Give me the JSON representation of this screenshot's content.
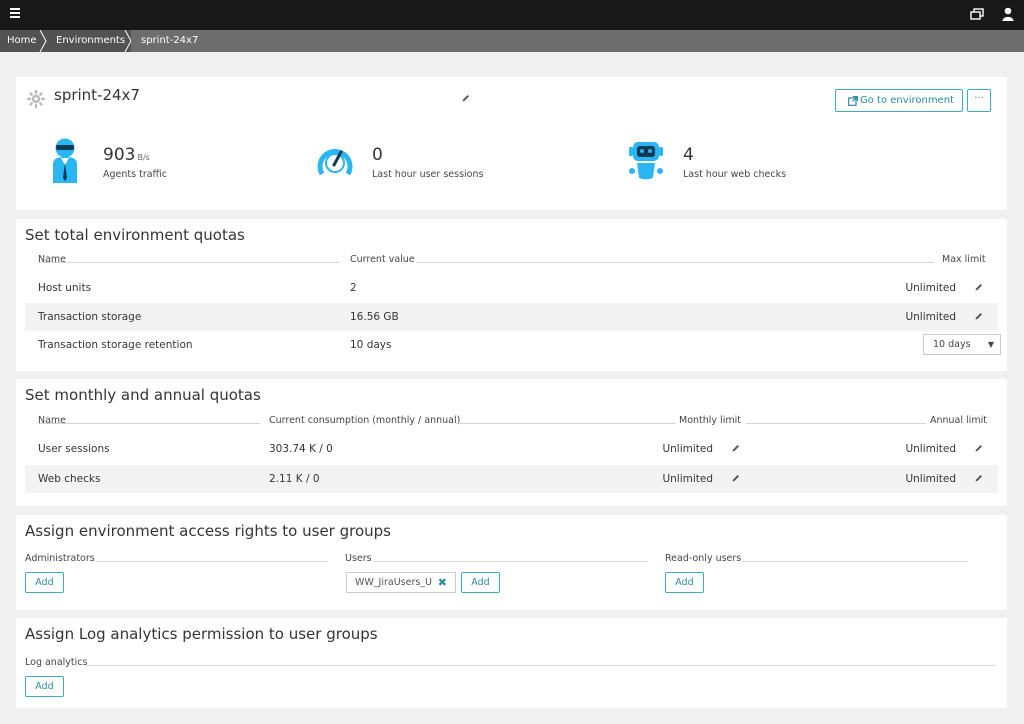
{
  "breadcrumb": [
    "Home",
    "Environments",
    "sprint-24x7"
  ],
  "environment": {
    "name": "sprint-24x7",
    "go_to_label": "Go to environment",
    "more_label": "···",
    "metrics": [
      {
        "value": "903",
        "unit": "B/s",
        "label": "Agents traffic"
      },
      {
        "value": "0",
        "unit": "",
        "label": "Last hour user sessions"
      },
      {
        "value": "4",
        "unit": "",
        "label": "Last hour web checks"
      }
    ]
  },
  "total_quotas": {
    "title": "Set total environment quotas",
    "headers": [
      "Name",
      "Current value",
      "Max limit"
    ],
    "rows": [
      {
        "name": "Host units",
        "value": "2",
        "limit": "Unlimited"
      },
      {
        "name": "Transaction storage",
        "value": "16.56 GB",
        "limit": "Unlimited"
      },
      {
        "name": "Transaction storage retention",
        "value": "10 days",
        "limit": "10 days"
      }
    ]
  },
  "monthly_quotas": {
    "title": "Set monthly and annual quotas",
    "headers": [
      "Name",
      "Current consumption (monthly / annual)",
      "Monthly limit",
      "Annual limit"
    ],
    "rows": [
      {
        "name": "User sessions",
        "value": "303.74 K / 0",
        "monthly": "Unlimited",
        "annual": "Unlimited"
      },
      {
        "name": "Web checks",
        "value": "2.11 K / 0",
        "monthly": "Unlimited",
        "annual": "Unlimited"
      }
    ]
  },
  "access_rights": {
    "title": "Assign environment access rights to user groups",
    "groups": [
      "Administrators",
      "Users",
      "Read-only users"
    ],
    "user_tag": "WW_JiraUsers_U",
    "add_label": "Add"
  },
  "log_analytics": {
    "title": "Assign Log analytics permission to user groups",
    "label": "Log analytics",
    "add_label": "Add"
  },
  "colors": {
    "accent": "#3eaebf",
    "icon_blue": "#2ab6f2",
    "topbar": "#181818"
  }
}
